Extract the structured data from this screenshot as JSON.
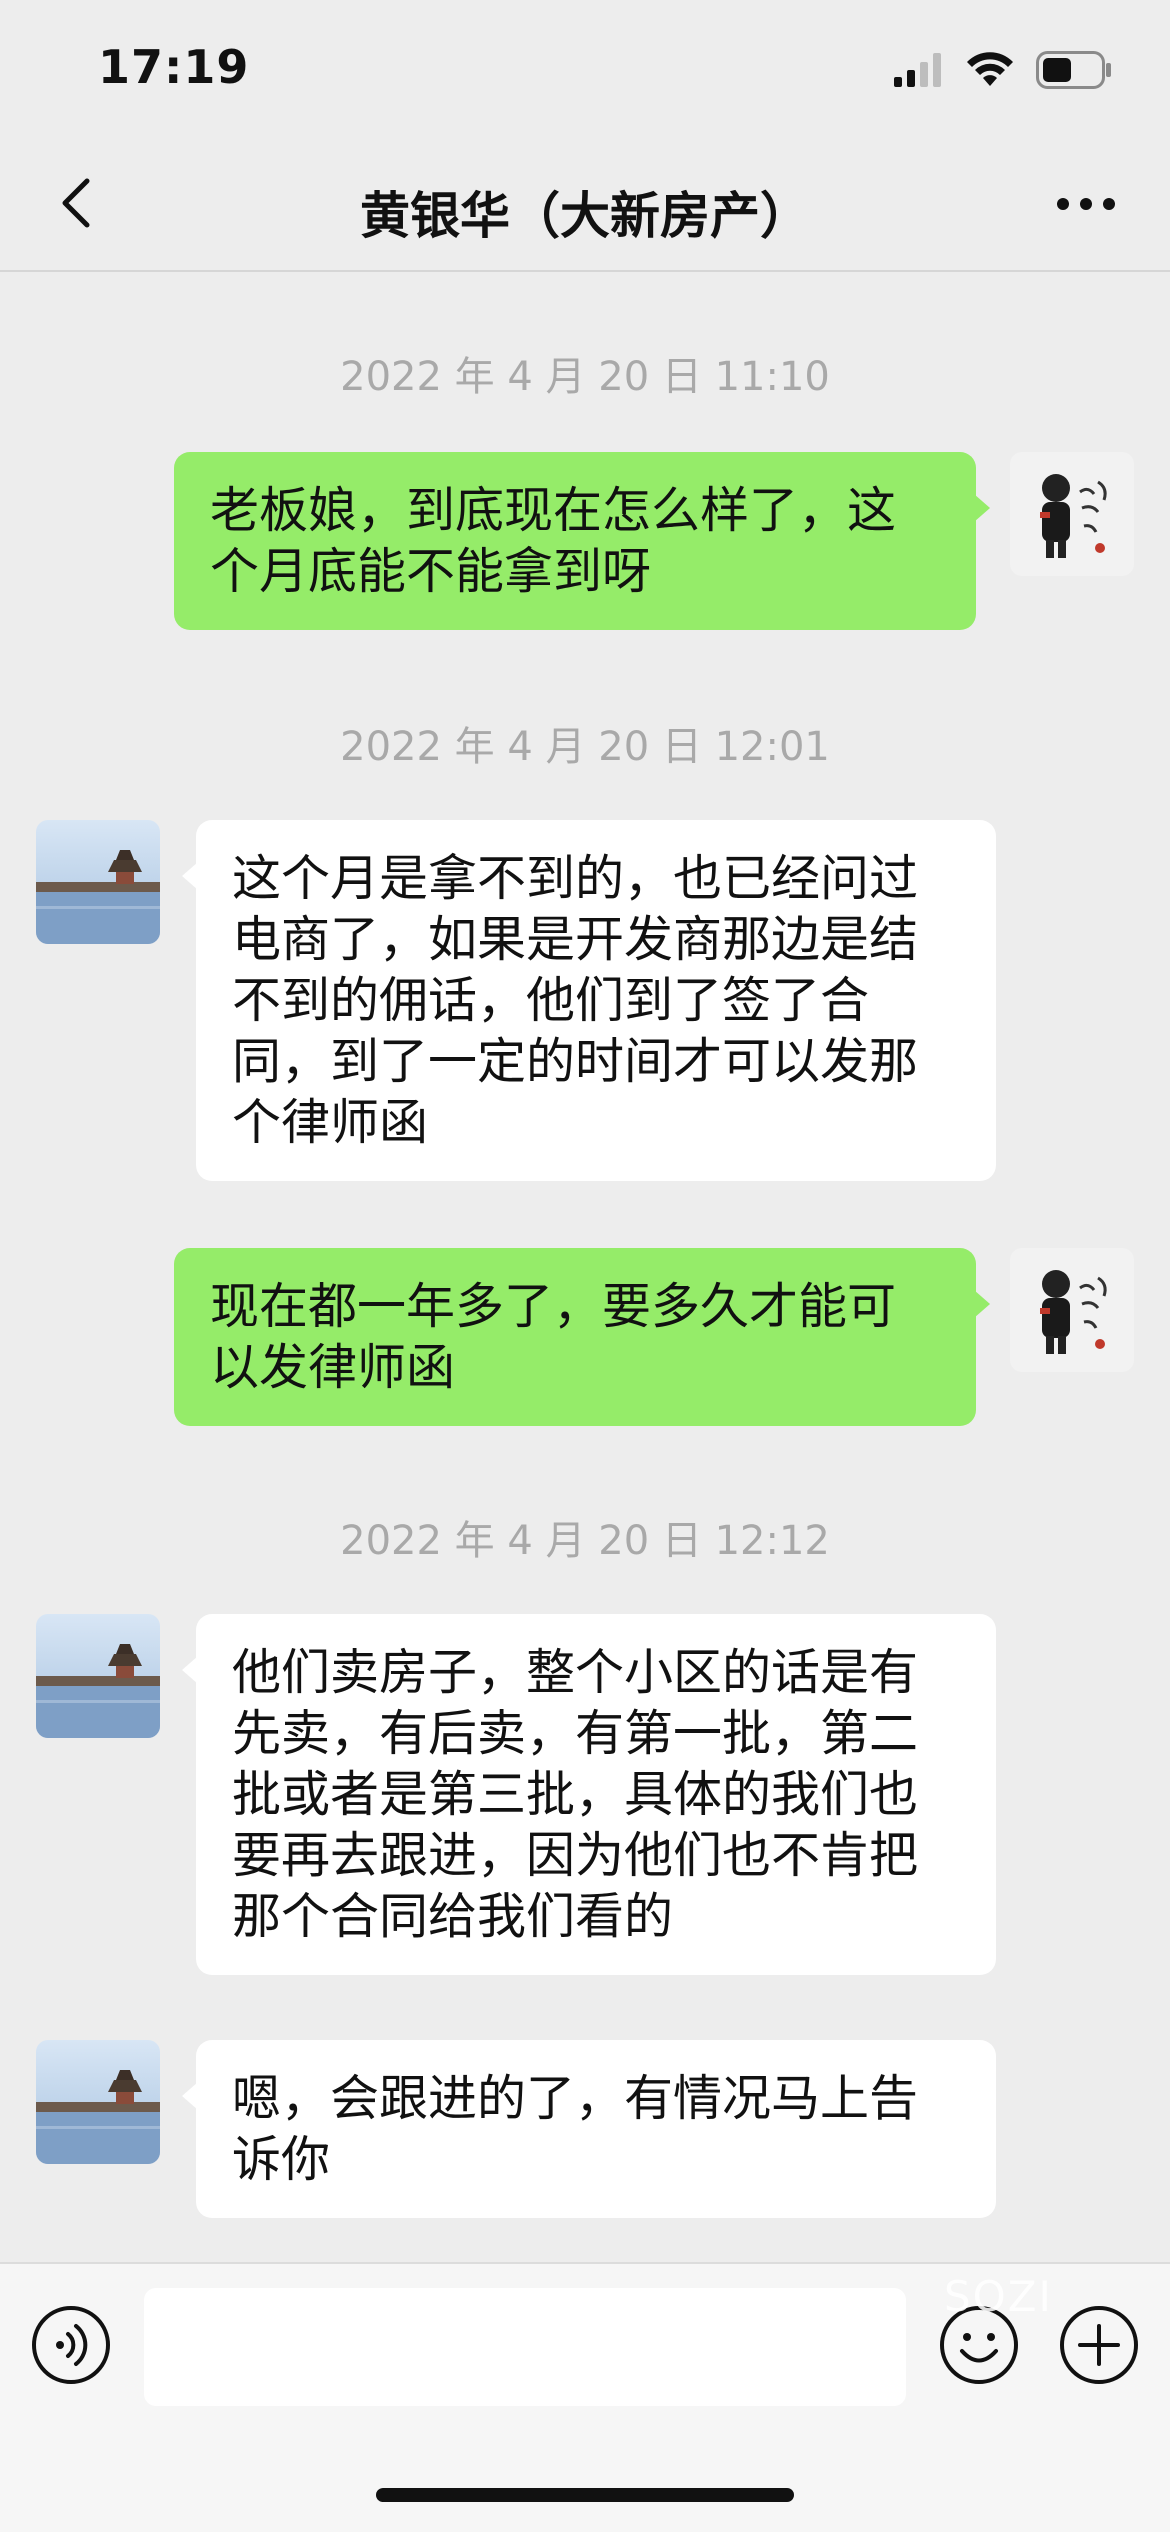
{
  "status_bar": {
    "time": "17:19"
  },
  "nav": {
    "title": "黄银华（大新房产）"
  },
  "messages": [
    {
      "type": "timestamp",
      "text": "2022 年 4 月 20 日 11:10"
    },
    {
      "type": "sent",
      "text": "老板娘，到底现在怎么样了，这个月底能不能拿到呀"
    },
    {
      "type": "timestamp",
      "text": "2022 年 4 月 20 日 12:01"
    },
    {
      "type": "received",
      "text": "这个月是拿不到的，也已经问过电商了，如果是开发商那边是结不到的佣话，他们到了签了合同，到了一定的时间才可以发那个律师函"
    },
    {
      "type": "sent",
      "text": "现在都一年多了，要多久才能可以发律师函"
    },
    {
      "type": "timestamp",
      "text": "2022 年 4 月 20 日 12:12"
    },
    {
      "type": "received",
      "text": "他们卖房子，整个小区的话是有先卖，有后卖，有第一批，第二批或者是第三批，具体的我们也要再去跟进，因为他们也不肯把那个合同给我们看的"
    },
    {
      "type": "received",
      "text": "嗯，会跟进的了，有情况马上告诉你"
    }
  ],
  "input": {
    "value": "",
    "placeholder": ""
  },
  "watermark": "SOZI",
  "icons": {
    "back": "chevron-left-icon",
    "more": "more-dots-icon",
    "voice": "voice-icon",
    "emoji": "emoji-icon",
    "plus": "plus-icon",
    "signal": "signal-icon",
    "wifi": "wifi-icon",
    "battery": "battery-icon"
  },
  "colors": {
    "sent_bubble": "#95ec69",
    "received_bubble": "#ffffff",
    "background": "#ededed",
    "timestamp": "#a9a9a9"
  }
}
